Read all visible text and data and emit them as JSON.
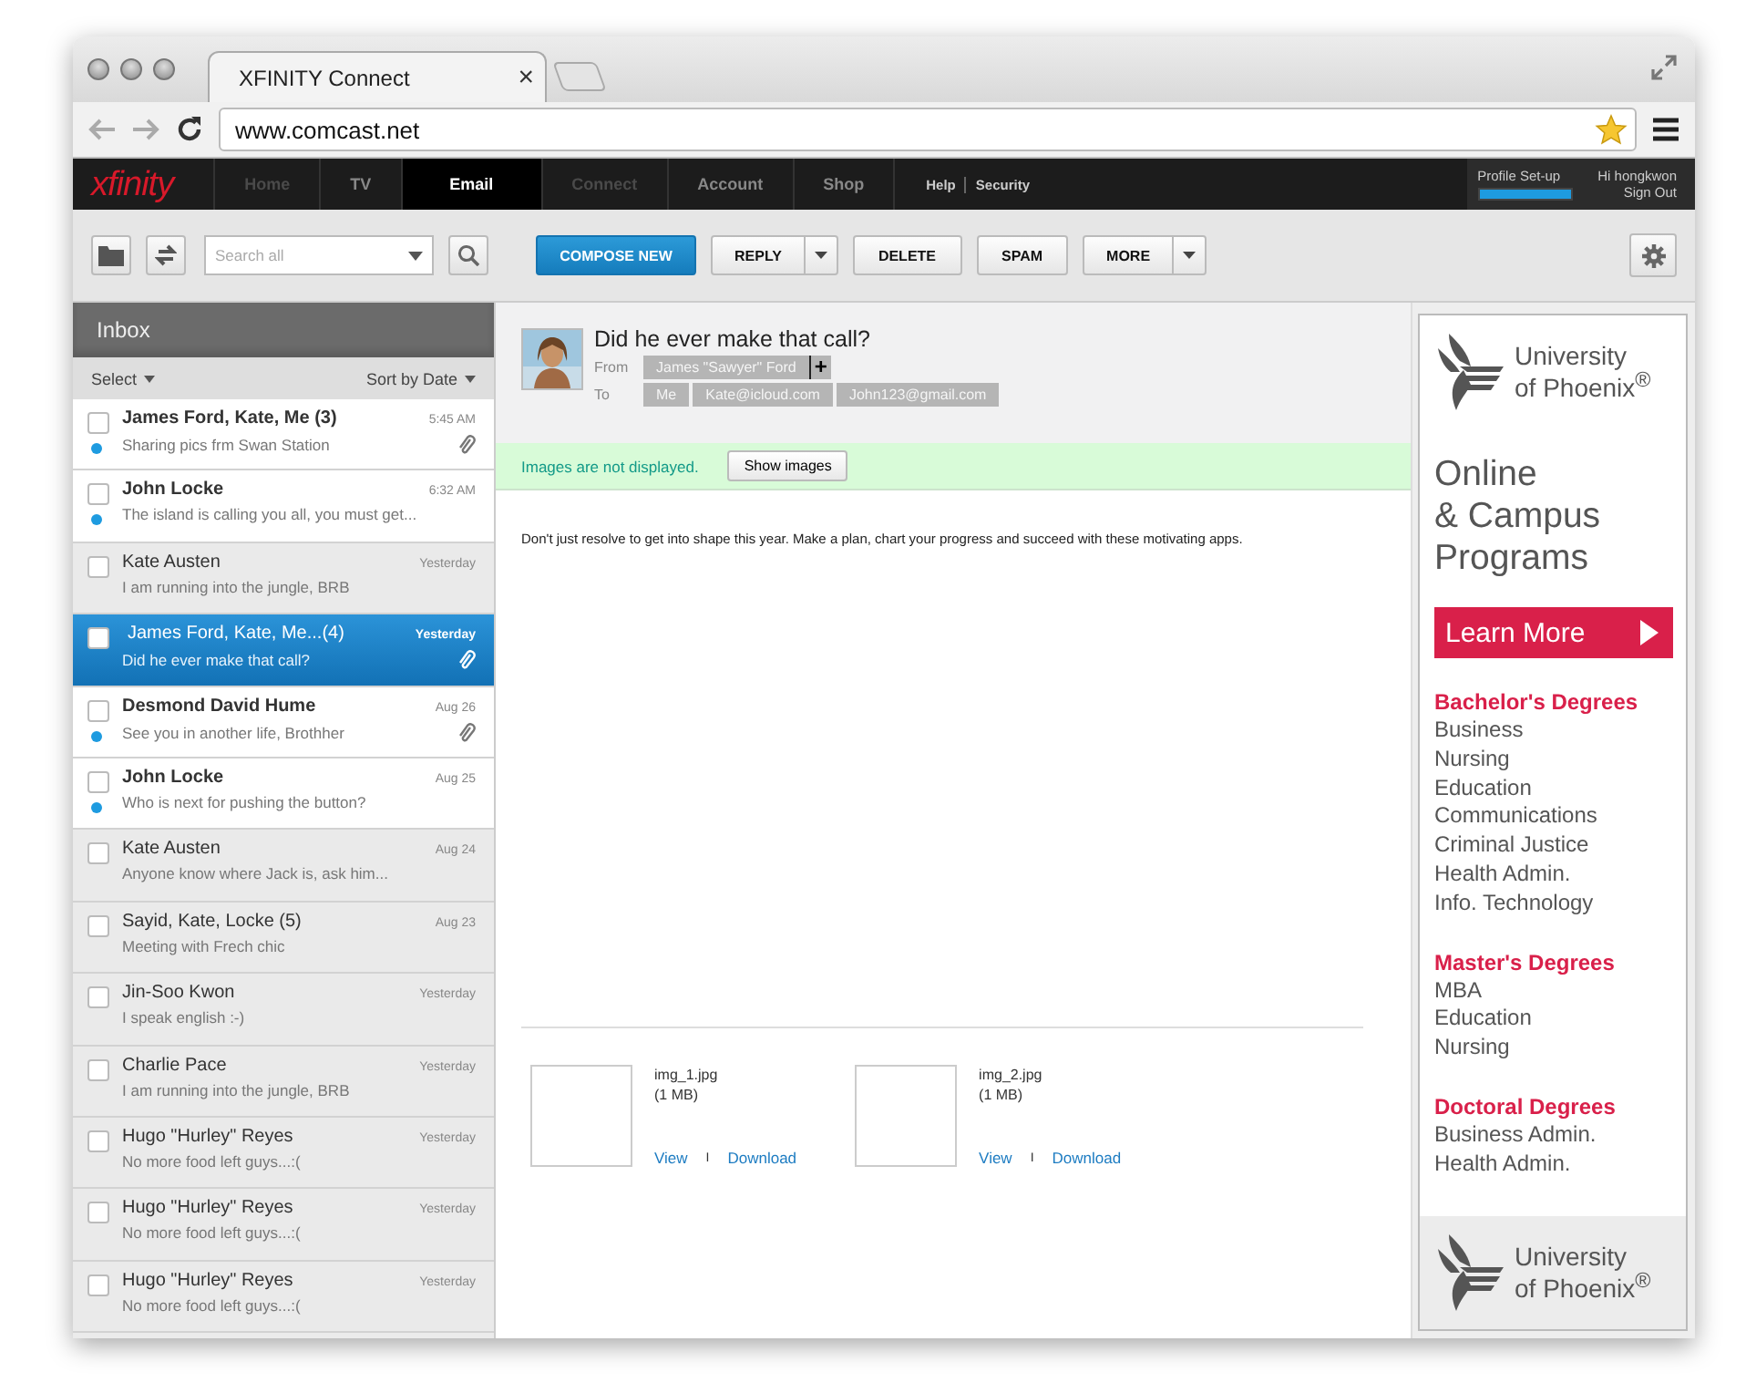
{
  "browser": {
    "tab_title": "XFINITY Connect",
    "tab_close": "×",
    "url": "www.comcast.net"
  },
  "nav": {
    "logo": "xfinity",
    "items": [
      {
        "label": "Home",
        "selected": false,
        "disabled": true
      },
      {
        "label": "TV",
        "selected": false,
        "disabled": false
      },
      {
        "label": "Email",
        "selected": true,
        "disabled": false
      },
      {
        "label": "Connect",
        "selected": false,
        "disabled": true
      },
      {
        "label": "Account",
        "selected": false,
        "disabled": false
      },
      {
        "label": "Shop",
        "selected": false,
        "disabled": false
      }
    ],
    "links": [
      "Help",
      "Security"
    ],
    "profile": {
      "label": "Profile Set-up",
      "level": 1
    },
    "greeting": "Hi hongkwon",
    "sign_out": "Sign Out"
  },
  "toolbar": {
    "search_placeholder": "Search all",
    "buttons": [
      {
        "label": "COMPOSE NEW",
        "kind": "primary"
      },
      {
        "label": "REPLY",
        "kind": "split"
      },
      {
        "label": "DELETE",
        "kind": "plain"
      },
      {
        "label": "SPAM",
        "kind": "plain"
      },
      {
        "label": "MORE",
        "kind": "split"
      }
    ]
  },
  "inbox": {
    "title": "Inbox",
    "select": "Select",
    "sort": "Sort by Date",
    "messages": [
      {
        "from": "James Ford, Kate, Me (3)",
        "time": "5:45 AM",
        "preview": "Sharing pics frm Swan Station",
        "unread": true,
        "selected": false,
        "attachment": true,
        "checked": false
      },
      {
        "from": "John Locke",
        "time": "6:32 AM",
        "preview": "The island is calling you all, you must get...",
        "unread": true,
        "selected": false,
        "attachment": false,
        "checked": false
      },
      {
        "from": "Kate Austen",
        "time": "Yesterday",
        "preview": "I am running into the jungle, BRB",
        "unread": false,
        "selected": false,
        "attachment": false,
        "checked": false
      },
      {
        "from": "James Ford, Kate, Me...(4)",
        "time": "Yesterday",
        "preview": "Did he ever make that call?",
        "unread": false,
        "selected": true,
        "attachment": true,
        "checked": false
      },
      {
        "from": "Desmond David Hume",
        "time": "Aug 26",
        "preview": "See you in another life, Brothher",
        "unread": true,
        "selected": false,
        "attachment": true,
        "checked": false
      },
      {
        "from": "John Locke",
        "time": "Aug 25",
        "preview": "Who is next for pushing the button?",
        "unread": true,
        "selected": false,
        "attachment": false,
        "checked": false
      },
      {
        "from": "Kate Austen",
        "time": "Aug 24",
        "preview": "Anyone know where Jack is, ask him...",
        "unread": false,
        "selected": false,
        "attachment": false,
        "checked": false
      },
      {
        "from": "Sayid, Kate, Locke (5)",
        "time": "Aug 23",
        "preview": "Meeting with Frech chic",
        "unread": false,
        "selected": false,
        "attachment": false,
        "checked": false
      },
      {
        "from": "Jin-Soo Kwon",
        "time": "Yesterday",
        "preview": "I speak english :-)",
        "unread": false,
        "selected": false,
        "attachment": false,
        "checked": false
      },
      {
        "from": "Charlie Pace",
        "time": "Yesterday",
        "preview": "I am running into the jungle, BRB",
        "unread": false,
        "selected": false,
        "attachment": false,
        "checked": false
      },
      {
        "from": "Hugo \"Hurley\" Reyes",
        "time": "Yesterday",
        "preview": "No more food left guys...:(",
        "unread": false,
        "selected": false,
        "attachment": false,
        "checked": false
      },
      {
        "from": "Hugo \"Hurley\" Reyes",
        "time": "Yesterday",
        "preview": "No more food left guys...:(",
        "unread": false,
        "selected": false,
        "attachment": false,
        "checked": false
      },
      {
        "from": "Hugo \"Hurley\" Reyes",
        "time": "Yesterday",
        "preview": "No more food left guys...:(",
        "unread": false,
        "selected": false,
        "attachment": false,
        "checked": false
      }
    ]
  },
  "message": {
    "subject": "Did he ever make that call?",
    "from_label": "From",
    "from": "James \"Sawyer\" Ford",
    "add": "+",
    "to_label": "To",
    "recipients": [
      "Me",
      "Kate@icloud.com",
      "John123@gmail.com"
    ],
    "notice": "Images are not displayed.",
    "show_images": "Show images",
    "body": "Don't just resolve to get into shape this year. Make a plan, chart your progress and succeed with these motivating apps.",
    "attachments": [
      {
        "name": "img_1.jpg",
        "size": "(1 MB)",
        "view": "View",
        "separator": "I",
        "download": "Download"
      },
      {
        "name": "img_2.jpg",
        "size": "(1 MB)",
        "view": "View",
        "separator": "I",
        "download": "Download"
      }
    ]
  },
  "ad": {
    "brand_line1": "University",
    "brand_line2": "of Phoenix$^{®}$",
    "headline": [
      "Online",
      "& Campus",
      "Programs"
    ],
    "cta": "Learn More",
    "sections": [
      {
        "title": "Bachelor's Degrees",
        "items": [
          "Business",
          "Nursing",
          "Education",
          "Communications",
          "Criminal Justice",
          "Health Admin.",
          "Info. Technology"
        ]
      },
      {
        "title": "Master's Degrees",
        "items": [
          "MBA",
          "Education",
          "Nursing"
        ]
      },
      {
        "title": "Doctoral Degrees",
        "items": [
          "Business Admin.",
          "Health Admin."
        ]
      }
    ],
    "footer_line1": "University",
    "footer_line2": "of Phoenix$^{®}$"
  }
}
